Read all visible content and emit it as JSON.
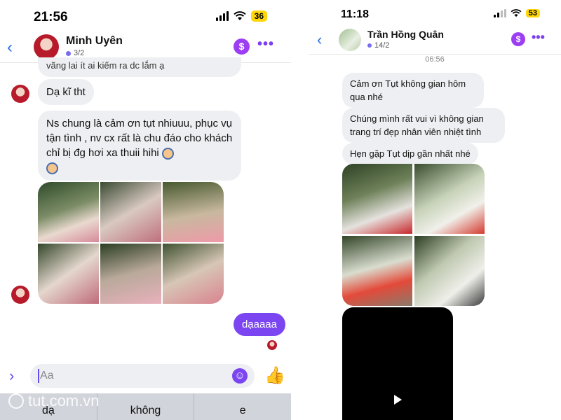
{
  "left": {
    "status": {
      "time": "21:56",
      "battery": "36"
    },
    "header": {
      "back": "‹",
      "name": "Minh Uyên",
      "sub": "3/2",
      "dollar": "$",
      "more": "•••"
    },
    "messages": {
      "partial": "vãng lai ít ai kiếm ra dc lắm ạ",
      "m1": "Dạ kĩ tht",
      "m2": "Ns chung là cảm ơn tụt nhiuuu, phục vụ tận tình , nv cx rất là chu đáo cho khách chỉ bị đg hơi xa thuii hihi",
      "mine": "dạaaaa"
    },
    "composer": {
      "chevron": "›",
      "placeholder": "Aa",
      "smile": "☺",
      "like": "👍"
    },
    "suggestions": [
      "dạ",
      "không",
      "e"
    ],
    "watermark": "tut.com.vn"
  },
  "right": {
    "status": {
      "time": "11:18",
      "battery": "53"
    },
    "header": {
      "back": "‹",
      "name": "Trần Hồng Quân",
      "sub": "14/2",
      "dollar": "$",
      "more": "•••"
    },
    "timestamp": "06:56",
    "messages": [
      "Cảm ơn Tụt không gian hôm qua nhé",
      "Chúng mình rất vui vì không gian trang trí đẹp nhân viên nhiệt tình",
      "Hẹn gặp Tụt dịp gần nhất nhé"
    ]
  }
}
